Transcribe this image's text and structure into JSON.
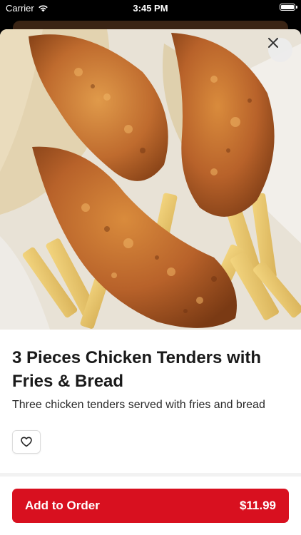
{
  "status_bar": {
    "carrier": "Carrier",
    "time": "3:45 PM"
  },
  "item": {
    "title": "3 Pieces Chicken Tenders with Fries & Bread",
    "description": "Three chicken tenders served with fries and bread"
  },
  "order_button": {
    "label": "Add to Order",
    "price": "$11.99"
  },
  "colors": {
    "accent": "#d8101f",
    "sheet_background": "#ffffff",
    "backdrop": "#000000"
  },
  "icons": {
    "close": "close-icon",
    "favorite": "heart-outline-icon",
    "wifi": "wifi-icon",
    "battery": "battery-icon"
  }
}
